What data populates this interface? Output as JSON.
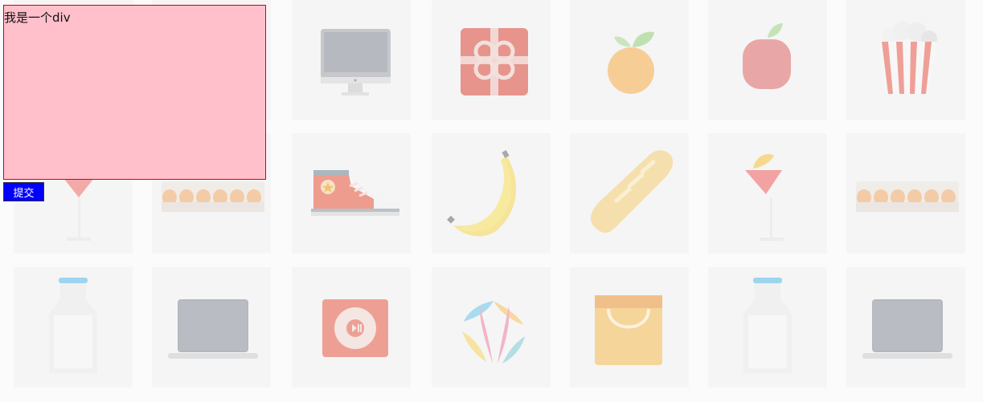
{
  "overlay": {
    "text": "我是一个div",
    "background": "#ffc0cb",
    "border_color": "#d40000"
  },
  "submit_button": {
    "label": "提交",
    "background": "#0000ff"
  },
  "tiles": [
    {
      "icon": "monitor-icon"
    },
    {
      "icon": "gift-icon"
    },
    {
      "icon": "orange-icon"
    },
    {
      "icon": "apple-icon"
    },
    {
      "icon": "popcorn-icon"
    },
    {
      "icon": "cocktail-icon"
    },
    {
      "icon": "eggs-icon"
    },
    {
      "icon": "sneaker-icon"
    },
    {
      "icon": "banana-icon"
    },
    {
      "icon": "bread-icon"
    },
    {
      "icon": "cocktail-icon"
    },
    {
      "icon": "eggs-icon"
    },
    {
      "icon": "milk-bottle-icon"
    },
    {
      "icon": "laptop-icon"
    },
    {
      "icon": "music-player-icon"
    },
    {
      "icon": "beach-ball-icon"
    },
    {
      "icon": "shopping-bag-icon"
    },
    {
      "icon": "milk-bottle-icon"
    },
    {
      "icon": "laptop-icon"
    }
  ]
}
